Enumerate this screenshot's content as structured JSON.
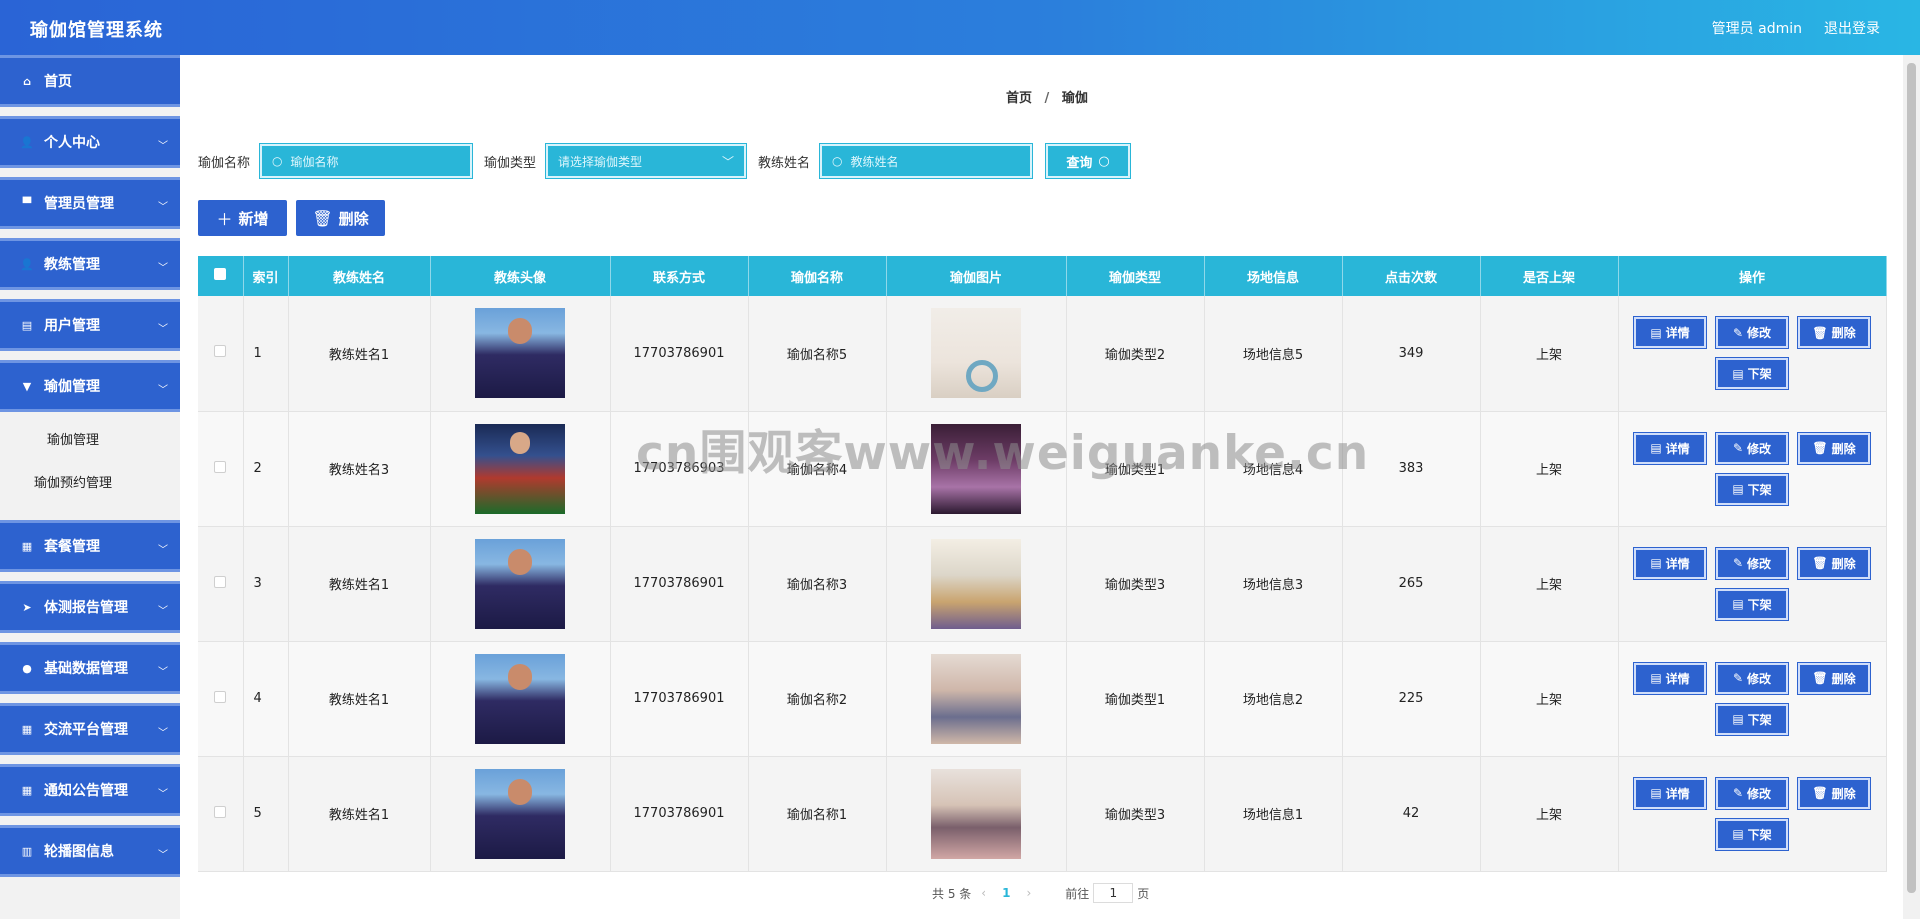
{
  "header": {
    "title": "瑜伽馆管理系统",
    "user": "管理员 admin",
    "logout": "退出登录"
  },
  "sidebar": {
    "items": [
      {
        "label": "首页",
        "icon": "⌂",
        "chevron": false
      },
      {
        "label": "个人中心",
        "icon": "👤",
        "chevron": true
      },
      {
        "label": "管理员管理",
        "icon": "▀",
        "chevron": true
      },
      {
        "label": "教练管理",
        "icon": "👤",
        "chevron": true
      },
      {
        "label": "用户管理",
        "icon": "▤",
        "chevron": true
      },
      {
        "label": "瑜伽管理",
        "icon": "▼",
        "chevron": true
      }
    ],
    "subitems": [
      "瑜伽管理",
      "瑜伽预约管理"
    ],
    "items2": [
      {
        "label": "套餐管理",
        "icon": "▦",
        "chevron": true
      },
      {
        "label": "体测报告管理",
        "icon": "➤",
        "chevron": true
      },
      {
        "label": "基础数据管理",
        "icon": "●",
        "chevron": true
      },
      {
        "label": "交流平台管理",
        "icon": "▦",
        "chevron": true
      },
      {
        "label": "通知公告管理",
        "icon": "▦",
        "chevron": true
      },
      {
        "label": "轮播图信息",
        "icon": "▥",
        "chevron": true
      }
    ]
  },
  "breadcrumb": {
    "home": "首页",
    "separator": "/",
    "current": "瑜伽"
  },
  "search": {
    "name_label": "瑜伽名称",
    "name_placeholder": "瑜伽名称",
    "type_label": "瑜伽类型",
    "type_placeholder": "请选择瑜伽类型",
    "coach_label": "教练姓名",
    "coach_placeholder": "教练姓名",
    "query_label": "查询"
  },
  "actions": {
    "add": "新增",
    "delete": "删除"
  },
  "table": {
    "headers": [
      "索引",
      "教练姓名",
      "教练头像",
      "联系方式",
      "瑜伽名称",
      "瑜伽图片",
      "瑜伽类型",
      "场地信息",
      "点击次数",
      "是否上架",
      "操作"
    ],
    "rows": [
      {
        "index": "1",
        "coach": "教练姓名1",
        "avatar": "coach-a",
        "phone": "17703786901",
        "yoga_name": "瑜伽名称5",
        "yoga_img": "yoga-1",
        "yoga_type": "瑜伽类型2",
        "venue": "场地信息5",
        "clicks": "349",
        "status": "上架"
      },
      {
        "index": "2",
        "coach": "教练姓名3",
        "avatar": "coach-b",
        "phone": "17703786903",
        "yoga_name": "瑜伽名称4",
        "yoga_img": "yoga-2",
        "yoga_type": "瑜伽类型1",
        "venue": "场地信息4",
        "clicks": "383",
        "status": "上架"
      },
      {
        "index": "3",
        "coach": "教练姓名1",
        "avatar": "coach-a",
        "phone": "17703786901",
        "yoga_name": "瑜伽名称3",
        "yoga_img": "yoga-3",
        "yoga_type": "瑜伽类型3",
        "venue": "场地信息3",
        "clicks": "265",
        "status": "上架"
      },
      {
        "index": "4",
        "coach": "教练姓名1",
        "avatar": "coach-a",
        "phone": "17703786901",
        "yoga_name": "瑜伽名称2",
        "yoga_img": "yoga-4",
        "yoga_type": "瑜伽类型1",
        "venue": "场地信息2",
        "clicks": "225",
        "status": "上架"
      },
      {
        "index": "5",
        "coach": "教练姓名1",
        "avatar": "coach-a",
        "phone": "17703786901",
        "yoga_name": "瑜伽名称1",
        "yoga_img": "yoga-5",
        "yoga_type": "瑜伽类型3",
        "venue": "场地信息1",
        "clicks": "42",
        "status": "上架"
      }
    ],
    "ops": {
      "detail": "详情",
      "edit": "修改",
      "delete": "删除",
      "offline": "下架"
    }
  },
  "pagination": {
    "total": "共 5 条",
    "current_page": "1",
    "goto_prefix": "前往",
    "goto_value": "1",
    "goto_suffix": "页"
  },
  "watermark": "cn围观客www.weiguanke.cn",
  "colors": {
    "header_start": "#2a64d6",
    "header_end": "#29b6e4",
    "sidebar": "#2d62cf",
    "table_header": "#29b6d8",
    "button": "#2d62cf"
  }
}
